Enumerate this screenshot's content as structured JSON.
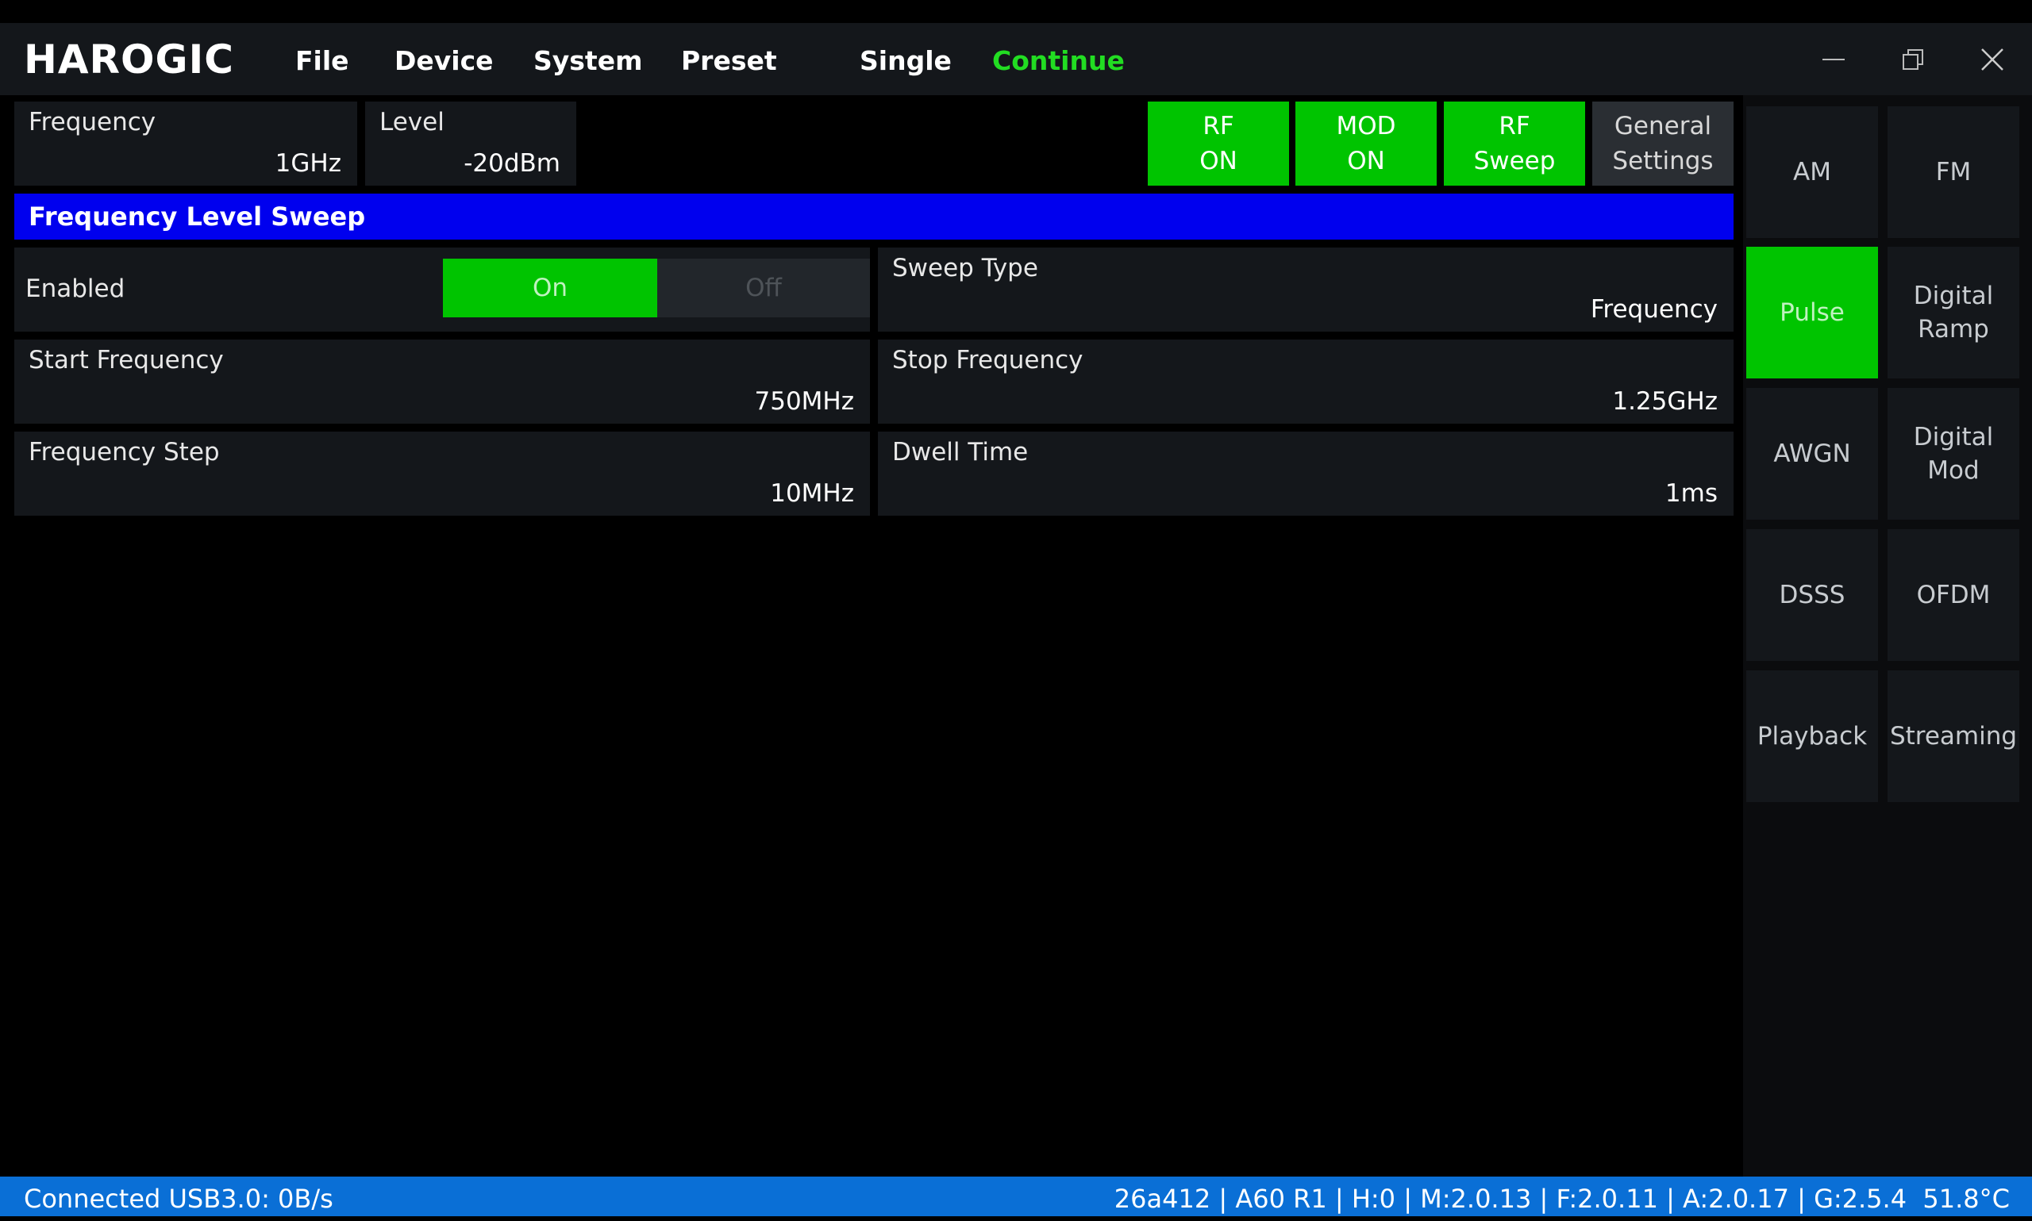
{
  "app": {
    "logo": "HAROGIC"
  },
  "menu": {
    "file": "File",
    "device": "Device",
    "system": "System",
    "preset": "Preset",
    "single": "Single",
    "continue": "Continue"
  },
  "colors": {
    "accent_green": "#00c400",
    "continue_green": "#22dd22",
    "banner_blue": "#0000ee",
    "status_blue": "#0a6fd6",
    "panel_bg": "#14171b"
  },
  "icons": {
    "minimize": "minimize-icon",
    "restore": "restore-icon",
    "close": "close-icon"
  },
  "frequency": {
    "label": "Frequency",
    "value": "1GHz"
  },
  "level": {
    "label": "Level",
    "value": "-20dBm"
  },
  "toggles": {
    "rf": {
      "line1": "RF",
      "line2": "ON"
    },
    "mod": {
      "line1": "MOD",
      "line2": "ON"
    },
    "sweep": {
      "line1": "RF",
      "line2": "Sweep"
    },
    "general": {
      "line1": "General",
      "line2": "Settings"
    }
  },
  "section": {
    "title": "Frequency Level Sweep"
  },
  "fields": {
    "enabled": {
      "label": "Enabled",
      "on": "On",
      "off": "Off",
      "selected": "On"
    },
    "sweep_type": {
      "label": "Sweep Type",
      "value": "Frequency"
    },
    "start_freq": {
      "label": "Start Frequency",
      "value": "750MHz"
    },
    "stop_freq": {
      "label": "Stop Frequency",
      "value": "1.25GHz"
    },
    "freq_step": {
      "label": "Frequency Step",
      "value": "10MHz"
    },
    "dwell": {
      "label": "Dwell Time",
      "value": "1ms"
    }
  },
  "sidebar": {
    "am": "AM",
    "fm": "FM",
    "pulse": "Pulse",
    "digital_ramp": {
      "line1": "Digital",
      "line2": "Ramp"
    },
    "awgn": "AWGN",
    "digital_mod": {
      "line1": "Digital",
      "line2": "Mod"
    },
    "dsss": "DSSS",
    "ofdm": "OFDM",
    "playback": "Playback",
    "streaming": "Streaming",
    "active": "Pulse"
  },
  "status": {
    "left": "Connected USB3.0: 0B/s",
    "right": "26a412 | A60 R1 | H:0 | M:2.0.13 | F:2.0.11 | A:2.0.17 | G:2.5.4  51.8°C"
  }
}
